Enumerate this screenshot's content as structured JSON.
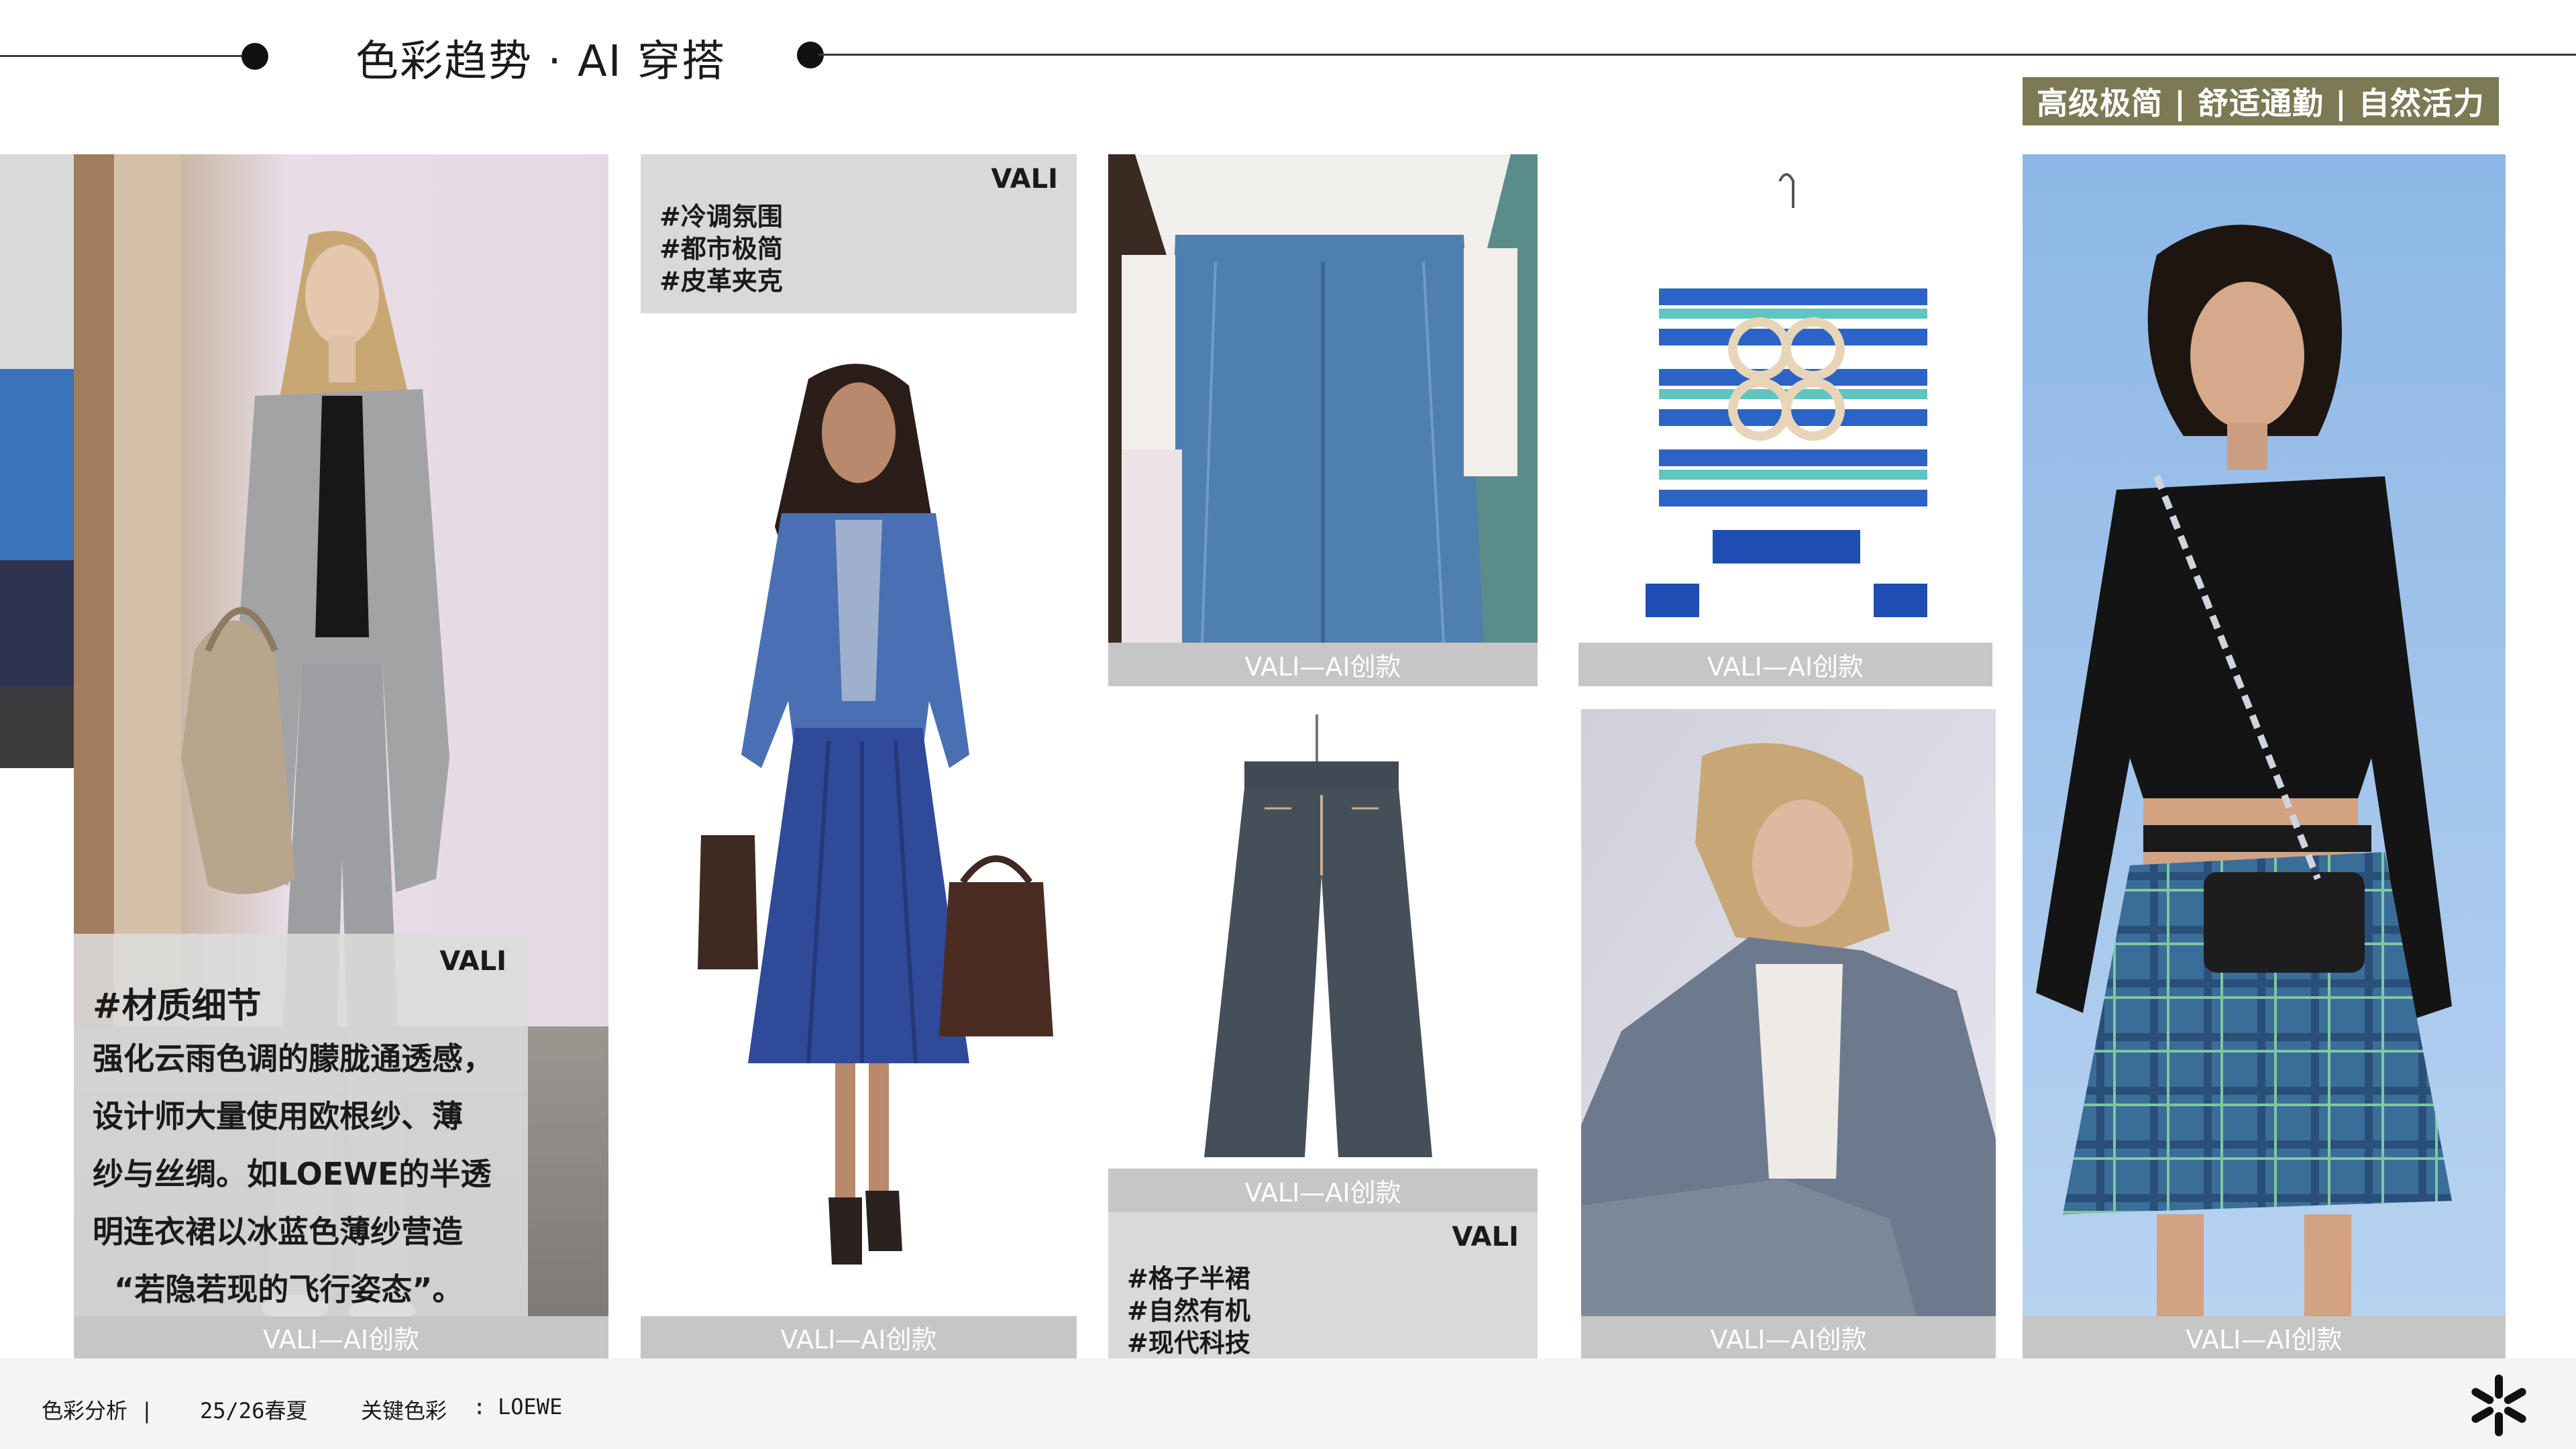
{
  "header": {
    "title": "色彩趋势 · AI 穿搭",
    "tags": "高级极简 | 舒适通勤 | 自然活力"
  },
  "palette": {
    "swatches": [
      "#d9d9dc",
      "#3a74b8",
      "#2f3350",
      "#3c3b3e"
    ]
  },
  "panel_left": {
    "brand": "VALI",
    "heading": "#材质细节",
    "body_lines": [
      "强化云雨色调的朦胧通透感，",
      "设计师大量使用欧根纱、薄",
      "纱与丝绸。如LOEWE的半透",
      "明连衣裙以冰蓝色薄纱营造",
      "“若隐若现的飞行姿态”。"
    ],
    "caption": "VALI—AI创款"
  },
  "panel_tags_top": {
    "brand": "VALI",
    "lines": [
      "#冷调氛围",
      "#都市极简",
      "#皮革夹克"
    ]
  },
  "panel_tags_bottom": {
    "brand": "VALI",
    "lines": [
      "#格子半裙",
      "#自然有机",
      "#现代科技"
    ]
  },
  "captions": {
    "model_skirt": "VALI—AI创款",
    "jeans": "VALI—AI创款",
    "sweater": "VALI—AI创款",
    "trousers": "VALI—AI创款",
    "blonde": "VALI—AI创款",
    "plaid": "VALI—AI创款"
  },
  "footer": {
    "section": "色彩分析 |",
    "season": "25/26春夏",
    "topic": "关键色彩",
    "sep": ":",
    "brand": "LOEWE"
  },
  "icons": {
    "logo": "asterisk-logo-icon"
  }
}
